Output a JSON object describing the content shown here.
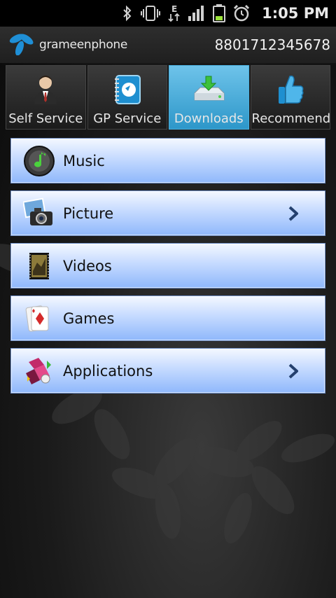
{
  "status_bar": {
    "time": "1:05 PM",
    "network_type": "E",
    "icons": [
      "bluetooth-icon",
      "vibrate-icon",
      "data-arrows-icon",
      "signal-icon",
      "battery-icon",
      "alarm-icon"
    ]
  },
  "header": {
    "brand": "grameenphone",
    "phone_number": "8801712345678"
  },
  "tabs": [
    {
      "label": "Self Service",
      "icon": "person-icon",
      "active": false
    },
    {
      "label": "GP Service",
      "icon": "service-notebook-icon",
      "active": false
    },
    {
      "label": "Downloads",
      "icon": "download-drive-icon",
      "active": true
    },
    {
      "label": "Recommend",
      "icon": "thumbs-up-icon",
      "active": false
    }
  ],
  "menu": {
    "items": [
      {
        "label": "Music",
        "icon": "music-icon",
        "has_arrow": false
      },
      {
        "label": "Picture",
        "icon": "camera-photo-icon",
        "has_arrow": true
      },
      {
        "label": "Videos",
        "icon": "video-film-icon",
        "has_arrow": false
      },
      {
        "label": "Games",
        "icon": "playing-card-icon",
        "has_arrow": false
      },
      {
        "label": "Applications",
        "icon": "applications-cube-icon",
        "has_arrow": true
      }
    ]
  },
  "colors": {
    "active_tab": "#3aa6d6",
    "menu_gradient_top": "#f4f8ff",
    "menu_gradient_bottom": "#8fb8fb",
    "chevron": "#24406e"
  }
}
